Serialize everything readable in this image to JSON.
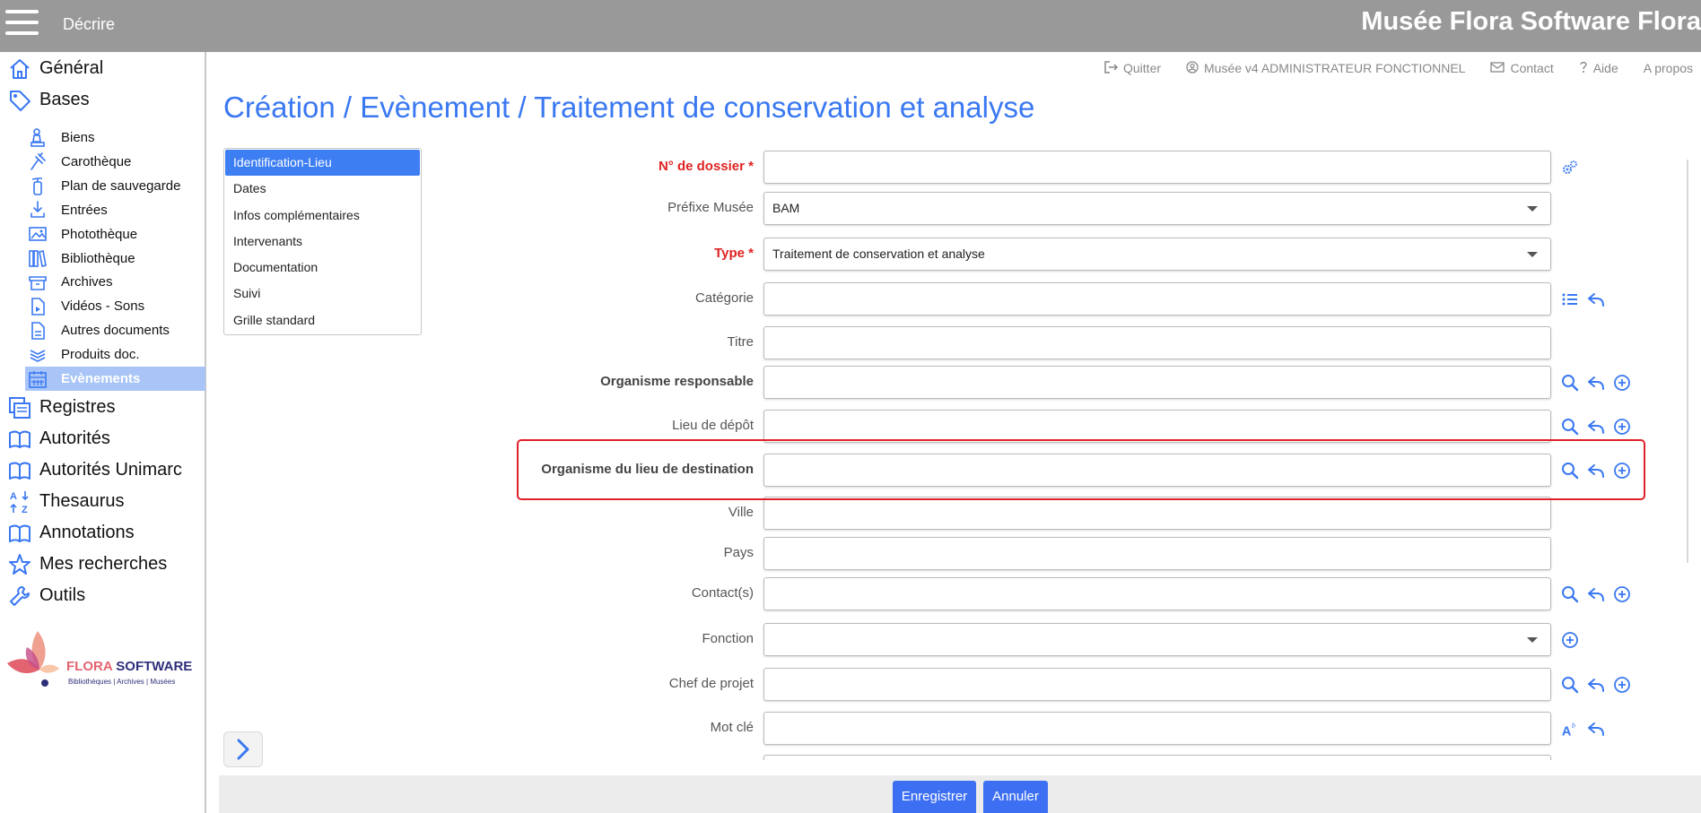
{
  "topbar": {
    "module_title": "Décrire",
    "app_title": "Musée Flora Software Flora",
    "color": "#999999"
  },
  "sidebar": {
    "main_top": [
      {
        "label": "Général",
        "icon": "home-icon"
      },
      {
        "label": "Bases",
        "icon": "tag-icon"
      }
    ],
    "sub_items": [
      {
        "label": "Biens",
        "icon": "statue-icon"
      },
      {
        "label": "Carothèque",
        "icon": "drill-icon"
      },
      {
        "label": "Plan de sauvegarde",
        "icon": "fire-extinguisher-icon"
      },
      {
        "label": "Entrées",
        "icon": "download-icon"
      },
      {
        "label": "Photothèque",
        "icon": "image-icon"
      },
      {
        "label": "Bibliothèque",
        "icon": "books-icon"
      },
      {
        "label": "Archives",
        "icon": "archive-box-icon"
      },
      {
        "label": "Vidéos - Sons",
        "icon": "video-file-icon"
      },
      {
        "label": "Autres documents",
        "icon": "document-icon"
      },
      {
        "label": "Produits doc.",
        "icon": "stack-icon"
      },
      {
        "label": "Evènements",
        "icon": "calendar-icon",
        "active": true
      }
    ],
    "main_bottom": [
      {
        "label": "Registres",
        "icon": "registers-icon"
      },
      {
        "label": "Autorités",
        "icon": "open-book-icon"
      },
      {
        "label": "Autorités Unimarc",
        "icon": "open-book-icon"
      },
      {
        "label": "Thesaurus",
        "icon": "az-sort-icon"
      },
      {
        "label": "Annotations",
        "icon": "open-book-icon"
      },
      {
        "label": "Mes recherches",
        "icon": "star-icon"
      },
      {
        "label": "Outils",
        "icon": "wrench-icon"
      }
    ],
    "active_color": "#a9c5f7",
    "icon_color": "#3a78f2"
  },
  "logo": {
    "brand_part1": "FLORA ",
    "brand_part2": "SOFTWARE",
    "tagline": "Bibliothèques | Archives | Musées"
  },
  "toplinks": [
    {
      "label": "Quitter",
      "icon": "logout-icon"
    },
    {
      "label": "Musée v4 ADMINISTRATEUR FONCTIONNEL",
      "icon": "user-circle-icon"
    },
    {
      "label": "Contact",
      "icon": "mail-icon"
    },
    {
      "label": "Aide",
      "icon": "question-icon"
    },
    {
      "label": "A propos",
      "icon": ""
    }
  ],
  "page_title": "Création / Evènement / Traitement de conservation et analyse",
  "tabs": [
    {
      "label": "Identification-Lieu",
      "active": true
    },
    {
      "label": "Dates"
    },
    {
      "label": "Infos complémentaires"
    },
    {
      "label": "Intervenants"
    },
    {
      "label": "Documentation"
    },
    {
      "label": "Suivi"
    },
    {
      "label": "Grille standard"
    }
  ],
  "form": {
    "fields": [
      {
        "label": "N° de dossier *",
        "value": "",
        "style": "req",
        "icons": [
          "gears-icon"
        ]
      },
      {
        "label": "Préfixe Musée",
        "value": "BAM",
        "select": true,
        "icons": []
      },
      {
        "label": "Type *",
        "value": "Traitement de conservation et analyse",
        "style": "req",
        "select": true,
        "icons": []
      },
      {
        "label": "Catégorie",
        "value": "",
        "icons": [
          "list-icon",
          "undo-arrow-icon"
        ]
      },
      {
        "label": "Titre",
        "value": "",
        "icons": []
      },
      {
        "label": "Organisme responsable",
        "value": "",
        "style": "bold",
        "icons": [
          "search-icon",
          "undo-arrow-icon",
          "add-circle-icon"
        ]
      },
      {
        "label": "Lieu de dépôt",
        "value": "",
        "icons": [
          "search-icon",
          "undo-arrow-icon",
          "add-circle-icon"
        ]
      },
      {
        "label": "Organisme du lieu de destination",
        "value": "",
        "style": "bold",
        "icons": [
          "search-icon",
          "undo-arrow-icon",
          "add-circle-icon"
        ]
      },
      {
        "label": "Ville",
        "value": "",
        "icons": []
      },
      {
        "label": "Pays",
        "value": "",
        "icons": []
      },
      {
        "label": "Contact(s)",
        "value": "",
        "icons": [
          "search-icon",
          "undo-arrow-icon",
          "add-circle-icon"
        ]
      },
      {
        "label": "Fonction",
        "value": "",
        "select": true,
        "icons": [
          "add-circle-icon"
        ]
      },
      {
        "label": "Chef de projet",
        "value": "",
        "icons": [
          "search-icon",
          "undo-arrow-icon",
          "add-circle-icon"
        ]
      },
      {
        "label": "Mot clé",
        "value": "",
        "icons": [
          "font-style-icon",
          "undo-arrow-icon"
        ]
      }
    ],
    "highlighted_field": "Organisme du lieu de destination",
    "highlight_color": "#e0202a"
  },
  "buttons": {
    "save": "Enregistrer",
    "cancel": "Annuler",
    "color": "#3d6ff2"
  },
  "accent_color": "#3a78f2"
}
